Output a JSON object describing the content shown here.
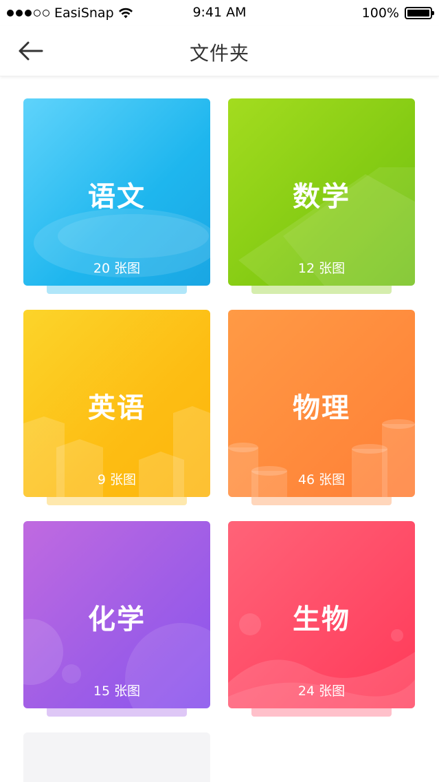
{
  "status_bar": {
    "carrier": "EasiSnap",
    "time": "9:41 AM",
    "battery": "100%",
    "signal_icon": "signal-dots-icon",
    "wifi_icon": "wifi-icon",
    "battery_icon": "battery-icon"
  },
  "nav": {
    "title": "文件夹",
    "back_icon": "arrow-left-icon"
  },
  "folders": [
    {
      "name": "语文",
      "count": "20 张图",
      "color": "#1eb6ee"
    },
    {
      "name": "数学",
      "count": "12 张图",
      "color": "#86cc14"
    },
    {
      "name": "英语",
      "count": "9 张图",
      "color": "#fdbd13"
    },
    {
      "name": "物理",
      "count": "46 张图",
      "color": "#ff8a3c"
    },
    {
      "name": "化学",
      "count": "15 张图",
      "color": "#a05ee6"
    },
    {
      "name": "生物",
      "count": "24 张图",
      "color": "#ff4a66"
    }
  ]
}
